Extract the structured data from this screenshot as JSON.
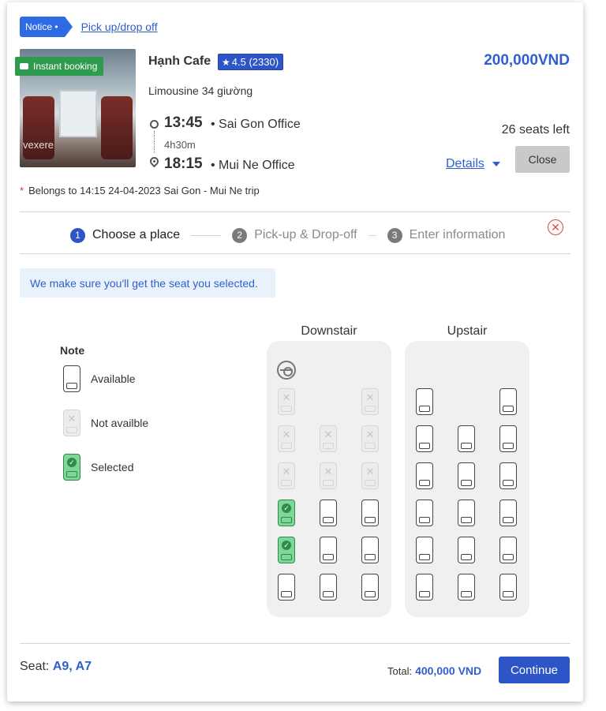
{
  "notice": {
    "badge": "Notice •",
    "link": "Pick up/drop off"
  },
  "trip": {
    "photo_watermark": "vexere",
    "instant_booking": "Instant booking",
    "operator": "Hạnh Cafe",
    "rating": "4.5 (2330)",
    "price": "200,000VND",
    "vehicle": "Limousine 34 giường",
    "depart_time": "13:45",
    "depart_place": "• Sai Gon Office",
    "duration": "4h30m",
    "arrive_time": "18:15",
    "arrive_place": "• Mui Ne Office",
    "seats_left": "26 seats left",
    "details_label": "Details",
    "close_label": "Close",
    "belongs_note": "Belongs to 14:15 24-04-2023 Sai Gon - Mui Ne trip"
  },
  "steps": [
    {
      "num": "1",
      "label": "Choose a place",
      "active": true
    },
    {
      "num": "2",
      "label": "Pick-up & Drop-off",
      "active": false
    },
    {
      "num": "3",
      "label": "Enter information",
      "active": false
    }
  ],
  "guarantee": "We make sure you'll get the seat you selected.",
  "legend": {
    "title": "Note",
    "available": "Available",
    "not_available": "Not availble",
    "selected": "Selected"
  },
  "decks": {
    "downstair_title": "Downstair",
    "upstair_title": "Upstair",
    "downstair_rows": [
      [
        "na",
        "",
        "na"
      ],
      [
        "na",
        "na",
        "na"
      ],
      [
        "na",
        "na",
        "na"
      ],
      [
        "sel",
        "av",
        "av"
      ],
      [
        "sel",
        "av",
        "av"
      ],
      [
        "av",
        "av",
        "av"
      ]
    ],
    "upstair_rows": [
      [
        "av",
        "",
        "av"
      ],
      [
        "av",
        "av",
        "av"
      ],
      [
        "av",
        "av",
        "av"
      ],
      [
        "av",
        "av",
        "av"
      ],
      [
        "av",
        "av",
        "av"
      ],
      [
        "av",
        "av",
        "av"
      ]
    ]
  },
  "footer": {
    "seat_label": "Seat:",
    "seat_value": "A9, A7",
    "total_label": "Total:",
    "total_value": "400,000 VND",
    "continue_label": "Continue"
  },
  "colors": {
    "brand_blue": "#2d55c8",
    "link_blue": "#2f5fcf",
    "instant_green": "#2e9b4f",
    "selected_green": "#7fd69a",
    "close_red": "#e0443c"
  }
}
